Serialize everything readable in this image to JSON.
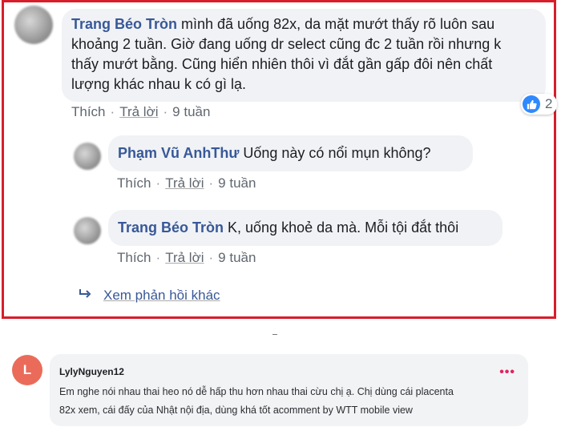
{
  "thread": {
    "main_comment": {
      "author": "Trang Béo Tròn",
      "text_lines": [
        " mình đã uống 82x, da mặt mướt thấy rõ luôn sau",
        "khoảng 2 tuần. Giờ đang uống dr select cũng đc 2 tuần rồi nhưng k",
        "thấy mướt bằng. Cũng hiển nhiên thôi vì đắt gần gấp đôi nên chất",
        "lượng khác nhau k có gì lạ."
      ],
      "like_label": "Thích",
      "reply_label": "Trả lời",
      "time": "9 tuần",
      "reaction_count": "2",
      "reaction_icon": "like-icon"
    },
    "replies": [
      {
        "author": "Phạm Vũ AnhThư",
        "text": " Uống này có nổi mụn không?",
        "like_label": "Thích",
        "reply_label": "Trả lời",
        "time": "9 tuần"
      },
      {
        "author": "Trang Béo Tròn",
        "text": " K, uống khoẻ da mà. Mỗi tội đắt thôi",
        "like_label": "Thích",
        "reply_label": "Trả lời",
        "time": "9 tuần"
      }
    ],
    "more_replies_label": "Xem phản hồi khác",
    "more_replies_icon": "reply-arrow-icon"
  },
  "lower_comment": {
    "avatar_letter": "L",
    "author": "LylyNguyen12",
    "text_lines": [
      "Em nghe nói nhau thai heo nó dễ hấp thu hơn nhau thai cừu chị ạ. Chị dùng cái placenta",
      "82x xem, cái đấy của Nhật nội địa, dùng khá tốt acomment by WTT mobile view"
    ],
    "menu_glyph": "•••",
    "menu_icon": "more-options-icon"
  },
  "colors": {
    "highlight_border": "#d81e2a",
    "author_link": "#385898",
    "bubble_bg": "#f0f2f5",
    "like_blue": "#2e89ff",
    "avatar_L": "#ea6b5a",
    "menu_dots": "#e0245e"
  }
}
